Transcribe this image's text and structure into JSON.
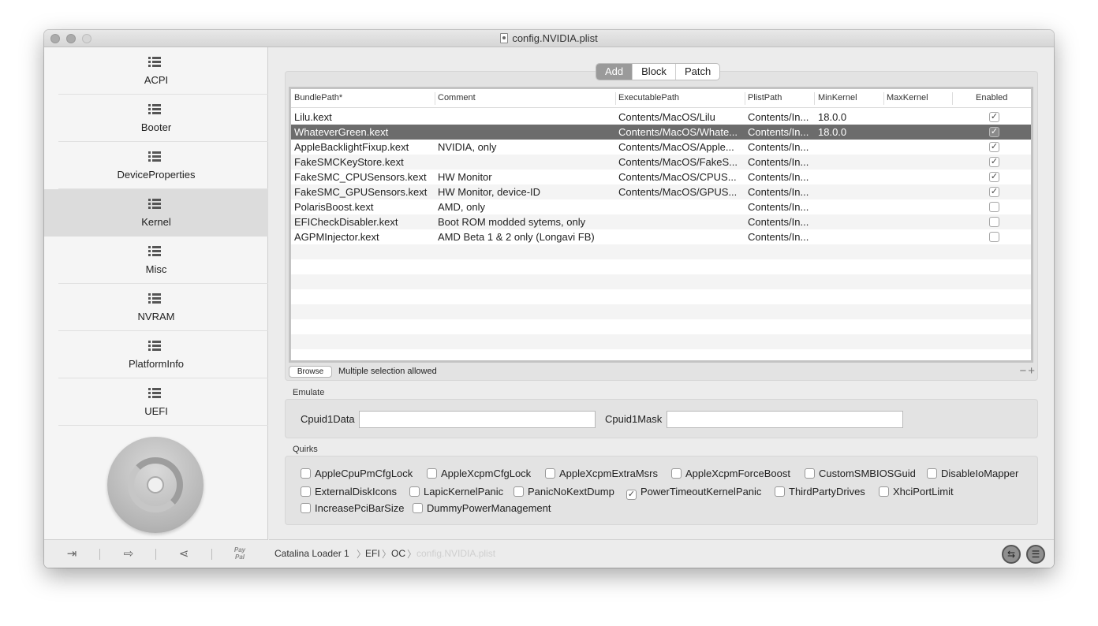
{
  "window": {
    "title": "config.NVIDIA.plist"
  },
  "sidebar": {
    "items": [
      {
        "label": "ACPI"
      },
      {
        "label": "Booter"
      },
      {
        "label": "DeviceProperties"
      },
      {
        "label": "Kernel",
        "active": true
      },
      {
        "label": "Misc"
      },
      {
        "label": "NVRAM"
      },
      {
        "label": "PlatformInfo"
      },
      {
        "label": "UEFI"
      }
    ],
    "bottom_buttons": [
      "import-icon",
      "export-icon",
      "share-icon",
      "paypal-icon"
    ],
    "paypal_text": "Pay Pal"
  },
  "tabs": {
    "items": [
      "Add",
      "Block",
      "Patch"
    ],
    "selected": "Add"
  },
  "table": {
    "columns": [
      "BundlePath*",
      "Comment",
      "ExecutablePath",
      "PlistPath",
      "MinKernel",
      "MaxKernel",
      "Enabled"
    ],
    "rows": [
      {
        "bundle": "Lilu.kext",
        "comment": "",
        "exec": "Contents/MacOS/Lilu",
        "plist": "Contents/In...",
        "min": "18.0.0",
        "max": "",
        "enabled": true
      },
      {
        "bundle": "WhateverGreen.kext",
        "comment": "",
        "exec": "Contents/MacOS/Whate...",
        "plist": "Contents/In...",
        "min": "18.0.0",
        "max": "",
        "enabled": true,
        "selected": true
      },
      {
        "bundle": "AppleBacklightFixup.kext",
        "comment": "NVIDIA, only",
        "exec": "Contents/MacOS/Apple...",
        "plist": "Contents/In...",
        "min": "",
        "max": "",
        "enabled": true
      },
      {
        "bundle": "FakeSMCKeyStore.kext",
        "comment": "",
        "exec": "Contents/MacOS/FakeS...",
        "plist": "Contents/In...",
        "min": "",
        "max": "",
        "enabled": true
      },
      {
        "bundle": "FakeSMC_CPUSensors.kext",
        "comment": "HW Monitor",
        "exec": "Contents/MacOS/CPUS...",
        "plist": "Contents/In...",
        "min": "",
        "max": "",
        "enabled": true
      },
      {
        "bundle": "FakeSMC_GPUSensors.kext",
        "comment": "HW Monitor, device-ID",
        "exec": "Contents/MacOS/GPUS...",
        "plist": "Contents/In...",
        "min": "",
        "max": "",
        "enabled": true
      },
      {
        "bundle": "PolarisBoost.kext",
        "comment": "AMD, only",
        "exec": "",
        "plist": "Contents/In...",
        "min": "",
        "max": "",
        "enabled": false
      },
      {
        "bundle": "EFICheckDisabler.kext",
        "comment": "Boot ROM modded sytems, only",
        "exec": "",
        "plist": "Contents/In...",
        "min": "",
        "max": "",
        "enabled": false
      },
      {
        "bundle": "AGPMInjector.kext",
        "comment": "AMD Beta 1 & 2 only (Longavi FB)",
        "exec": "",
        "plist": "Contents/In...",
        "min": "",
        "max": "",
        "enabled": false
      }
    ],
    "browse_label": "Browse",
    "selection_note": "Multiple selection allowed",
    "minus_plus": "−+"
  },
  "emulate": {
    "section_label": "Emulate",
    "cpuid1data_label": "Cpuid1Data",
    "cpuid1data_value": "",
    "cpuid1mask_label": "Cpuid1Mask",
    "cpuid1mask_value": ""
  },
  "quirks": {
    "section_label": "Quirks",
    "items": [
      {
        "label": "AppleCpuPmCfgLock",
        "checked": false
      },
      {
        "label": "AppleXcpmCfgLock",
        "checked": false
      },
      {
        "label": "AppleXcpmExtraMsrs",
        "checked": false
      },
      {
        "label": "AppleXcpmForceBoost",
        "checked": false
      },
      {
        "label": "CustomSMBIOSGuid",
        "checked": false
      },
      {
        "label": "DisableIoMapper",
        "checked": false
      },
      {
        "label": "ExternalDiskIcons",
        "checked": false
      },
      {
        "label": "LapicKernelPanic",
        "checked": false
      },
      {
        "label": "PanicNoKextDump",
        "checked": false
      },
      {
        "label": "PowerTimeoutKernelPanic",
        "checked": true
      },
      {
        "label": "ThirdPartyDrives",
        "checked": false
      },
      {
        "label": "XhciPortLimit",
        "checked": false
      },
      {
        "label": "IncreasePciBarSize",
        "checked": false
      },
      {
        "label": "DummyPowerManagement",
        "checked": false
      }
    ]
  },
  "pathbar": {
    "crumbs": [
      "Catalina Loader 1",
      "EFI",
      "OC",
      "config.NVIDIA.plist"
    ],
    "right_buttons": [
      "swap-icon",
      "list-icon"
    ]
  },
  "colors": {
    "selected_row": "#6c6c6c",
    "active_sidebar": "#dcdcdc",
    "active_tab": "#9a9a9a"
  }
}
